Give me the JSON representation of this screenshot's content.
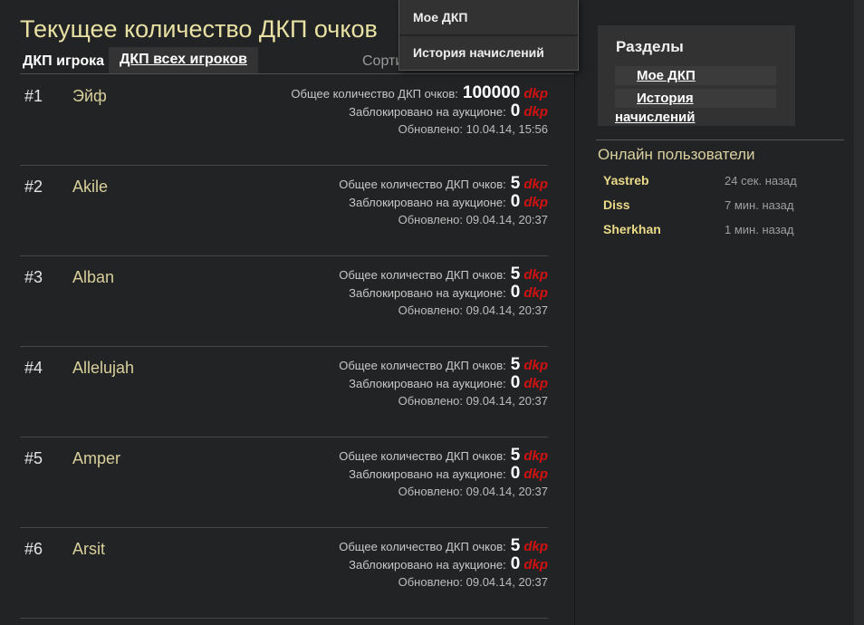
{
  "page": {
    "title": "Текущее количество ДКП очков",
    "sort_label": "Сорти"
  },
  "tabs": {
    "player": "ДКП игрока",
    "all_players": "ДКП всех игроков"
  },
  "dropdown": {
    "items": [
      "Мое ДКП",
      "История начислений"
    ]
  },
  "labels": {
    "total": "Общее количество ДКП очков:",
    "blocked": "Заблокировано на аукционе:",
    "dkp": "dkp"
  },
  "players": [
    {
      "rank": "#1",
      "name": "Эйф",
      "total": "100000",
      "blocked": "0",
      "updated": "Обновлено: 10.04.14, 15:56"
    },
    {
      "rank": "#2",
      "name": "Akile",
      "total": "5",
      "blocked": "0",
      "updated": "Обновлено: 09.04.14, 20:37"
    },
    {
      "rank": "#3",
      "name": "Alban",
      "total": "5",
      "blocked": "0",
      "updated": "Обновлено: 09.04.14, 20:37"
    },
    {
      "rank": "#4",
      "name": "Allelujah",
      "total": "5",
      "blocked": "0",
      "updated": "Обновлено: 09.04.14, 20:37"
    },
    {
      "rank": "#5",
      "name": "Amper",
      "total": "5",
      "blocked": "0",
      "updated": "Обновлено: 09.04.14, 20:37"
    },
    {
      "rank": "#6",
      "name": "Arsit",
      "total": "5",
      "blocked": "0",
      "updated": "Обновлено: 09.04.14, 20:37"
    }
  ],
  "sidebar": {
    "sections_title": "Разделы",
    "links": [
      "Мое ДКП",
      "История начислений"
    ],
    "online_title": "Онлайн пользователи",
    "online_users": [
      {
        "name": "Yastreb",
        "time": "24 сек. назад"
      },
      {
        "name": "Diss",
        "time": "7 мин. назад"
      },
      {
        "name": "Sherkhan",
        "time": "1 мин. назад"
      }
    ]
  },
  "colors": {
    "background": "#222324",
    "accent_yellow": "#e9e1a3",
    "name_yellow": "#d8cf9b",
    "online_name_yellow": "#ead989",
    "dkp_red": "#d01212",
    "panel_bg": "#323232",
    "box_bg": "#3b3b3b"
  }
}
